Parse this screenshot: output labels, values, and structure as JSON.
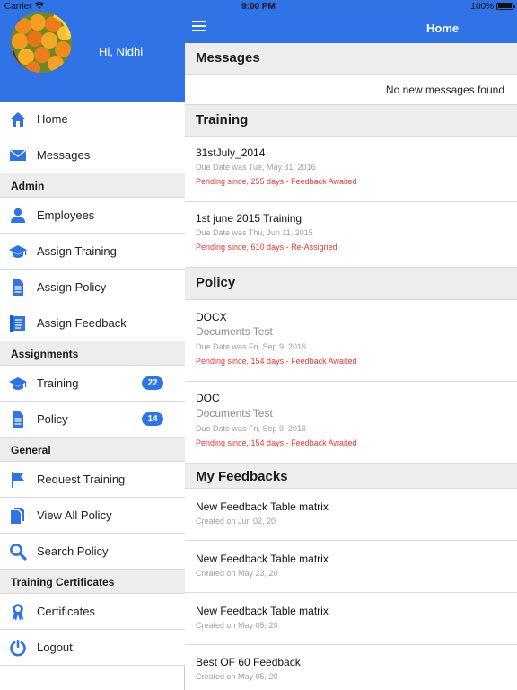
{
  "status_bar": {
    "carrier": "Carrier",
    "time": "9:00 PM",
    "battery": "100%"
  },
  "sidebar": {
    "greeting": "Hi, Nidhi",
    "items": [
      {
        "label": "Home",
        "icon": "home-icon"
      },
      {
        "label": "Messages",
        "icon": "mail-icon"
      },
      {
        "section": "Admin"
      },
      {
        "label": "Employees",
        "icon": "person-icon"
      },
      {
        "label": "Assign Training",
        "icon": "graduation-cap-icon"
      },
      {
        "label": "Assign Policy",
        "icon": "document-icon"
      },
      {
        "label": "Assign Feedback",
        "icon": "feedback-icon"
      },
      {
        "section": "Assignments"
      },
      {
        "label": "Training",
        "icon": "graduation-cap-icon",
        "badge": "22"
      },
      {
        "label": "Policy",
        "icon": "document-icon",
        "badge": "14"
      },
      {
        "section": "General"
      },
      {
        "label": "Request Training",
        "icon": "flag-icon"
      },
      {
        "label": "View All Policy",
        "icon": "documents-icon"
      },
      {
        "label": "Search Policy",
        "icon": "search-icon"
      },
      {
        "section": "Training Certificates"
      },
      {
        "label": "Certificates",
        "icon": "award-icon"
      },
      {
        "label": "Logout",
        "icon": "power-icon"
      }
    ]
  },
  "navbar": {
    "title": "Home"
  },
  "main": {
    "messages": {
      "header": "Messages",
      "empty_text": "No new messages found"
    },
    "training": {
      "header": "Training",
      "items": [
        {
          "title": "31stJuly_2014",
          "due": "Due Date was Tue, May 31, 2016",
          "status": "Pending since, 255 days - Feedback Awaited"
        },
        {
          "title": "1st june 2015 Training",
          "due": "Due Date was Thu, Jun 11, 2015",
          "status": "Pending since, 610 days - Re-Assigned"
        }
      ]
    },
    "policy": {
      "header": "Policy",
      "items": [
        {
          "title": "DOCX",
          "subtitle": "Documents Test",
          "due": "Due Date was Fri, Sep 9, 2016",
          "status": "Pending since, 154 days - Feedback Awaited"
        },
        {
          "title": "DOC",
          "subtitle": "Documents Test",
          "due": "Due Date was Fri, Sep 9, 2016",
          "status": "Pending since, 154 days - Feedback Awaited"
        }
      ]
    },
    "feedbacks": {
      "header": "My Feedbacks",
      "items": [
        {
          "title": "New Feedback Table matrix",
          "created": "Created on Jun 02, 20"
        },
        {
          "title": "New Feedback Table matrix",
          "created": "Created on May 23, 20"
        },
        {
          "title": "New Feedback Table matrix",
          "created": "Created on May 05, 20"
        },
        {
          "title": "Best OF 60 Feedback",
          "created": "Created on May 05, 20"
        }
      ]
    }
  },
  "colors": {
    "primary": "#2f73e6",
    "section_bg": "#ededed",
    "pending": "#e53935",
    "muted": "#8c8c8c"
  }
}
